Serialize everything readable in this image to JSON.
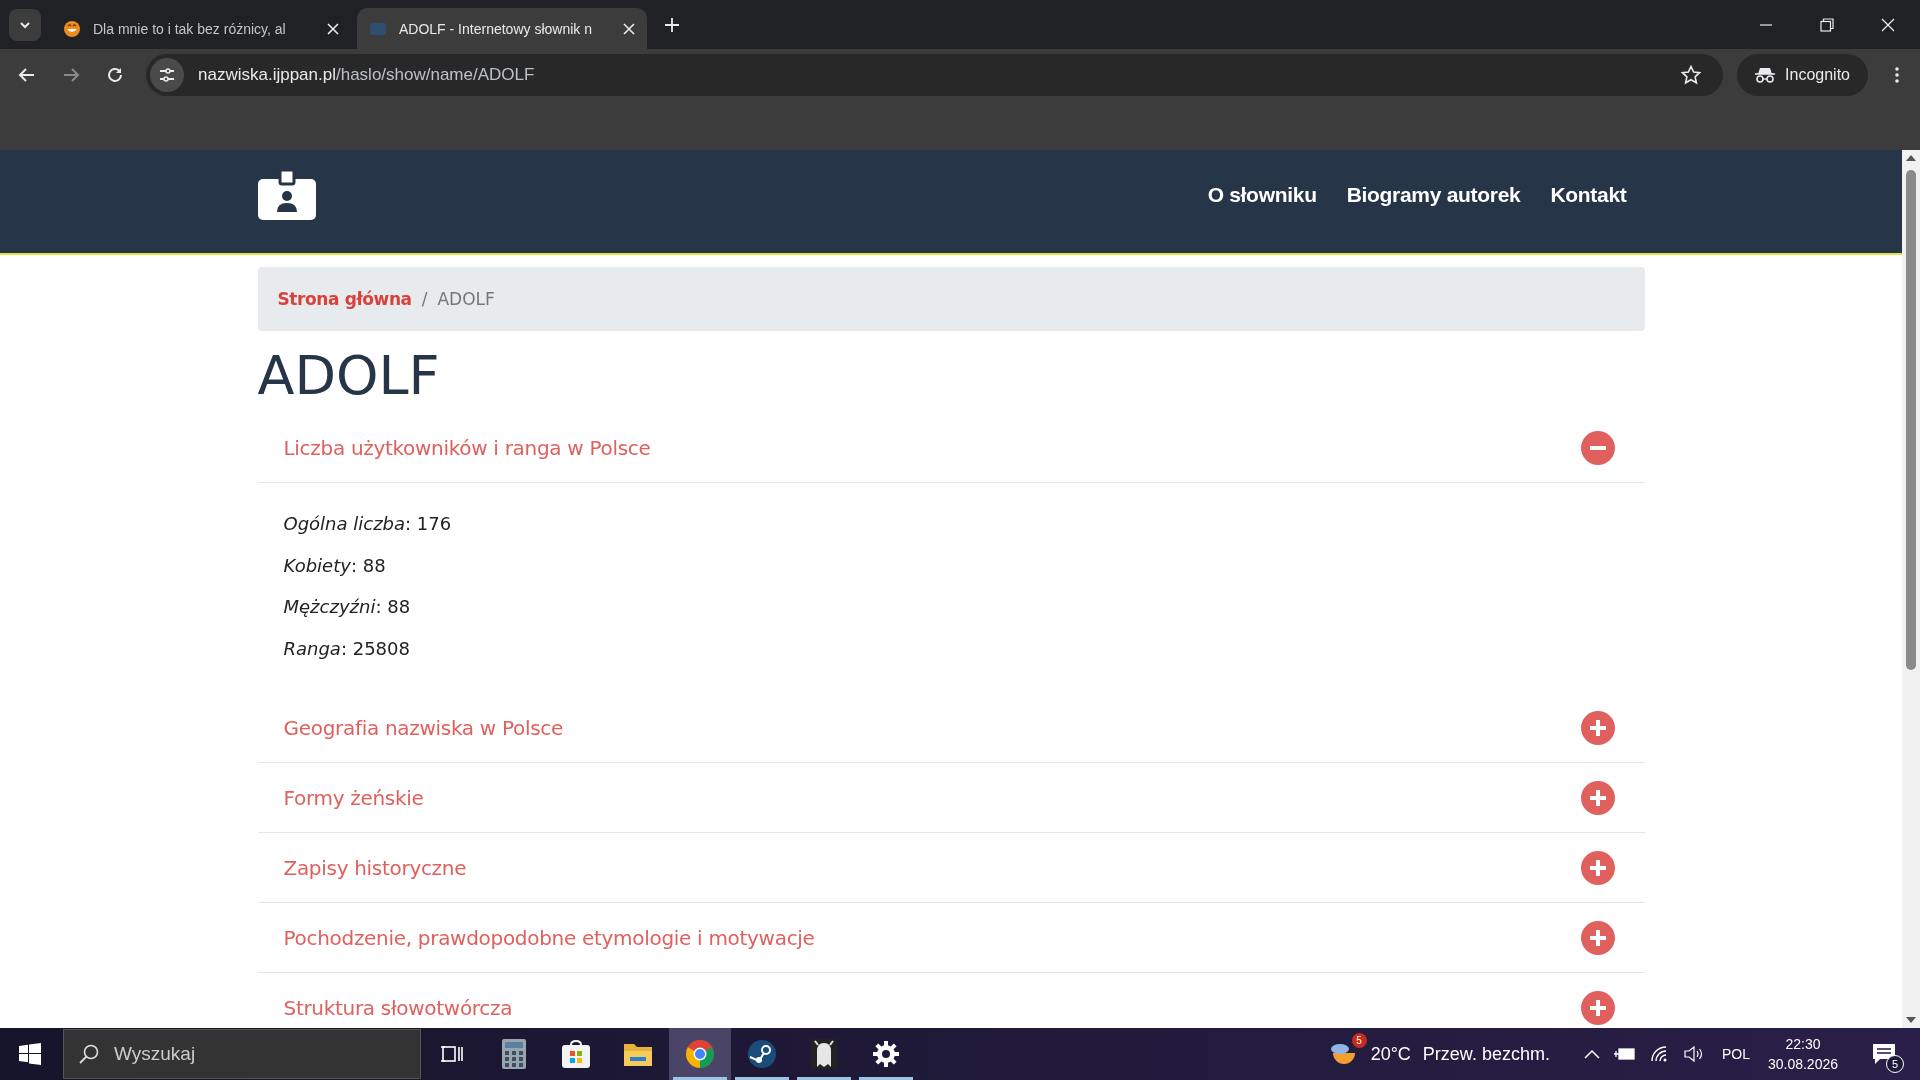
{
  "browser": {
    "tabs": [
      {
        "title": "Dla mnie to i tak bez różnicy, al",
        "selected": false
      },
      {
        "title": "ADOLF - Internetowy słownik n",
        "selected": true
      }
    ],
    "url_host": "nazwiska.ijppan.pl",
    "url_path": "/haslo/show/name/ADOLF",
    "profile": "Incognito"
  },
  "site": {
    "nav": [
      "O słowniku",
      "Biogramy autorek",
      "Kontakt"
    ],
    "breadcrumb_separator": "/",
    "breadcrumb": [
      {
        "label": "Strona główna",
        "kind": "link"
      },
      {
        "label": "ADOLF",
        "kind": "current"
      }
    ],
    "title": "ADOLF",
    "sections": [
      {
        "title": "Liczba użytkowników i ranga w Polsce",
        "expanded": true,
        "fields": [
          "*Ogólna liczba*: 176",
          "*Kobiety*: 88",
          "*Mężczyźni*: 88",
          "*Ranga*: 25808"
        ]
      },
      {
        "title": "Geografia nazwiska w Polsce",
        "expanded": false
      },
      {
        "title": "Formy żeńskie",
        "expanded": false
      },
      {
        "title": "Zapisy historyczne",
        "expanded": false
      },
      {
        "title": "Pochodzenie, prawdopodobne etymologie i motywacje",
        "expanded": false
      },
      {
        "title": "Struktura słowotwórcza",
        "expanded": false
      }
    ]
  },
  "taskbar": {
    "search_placeholder": "Wyszukaj",
    "apps": [
      {
        "kind": "task-view",
        "selected": false,
        "running": false
      },
      {
        "kind": "calculator",
        "selected": false,
        "running": false
      },
      {
        "kind": "store",
        "selected": false,
        "running": false
      },
      {
        "kind": "folder",
        "selected": false,
        "running": false
      },
      {
        "kind": "chrome",
        "selected": true,
        "running": true
      },
      {
        "kind": "steam",
        "selected": false,
        "running": true
      },
      {
        "kind": "ghost",
        "selected": false,
        "running": true
      },
      {
        "kind": "settings",
        "selected": false,
        "running": true
      }
    ],
    "weather": {
      "badge": "5",
      "temperature": "20°C",
      "condition": "Przew. bezchm."
    },
    "language": "POL",
    "time": "22:30",
    "date": "30.08.2026",
    "notifications": "5"
  }
}
